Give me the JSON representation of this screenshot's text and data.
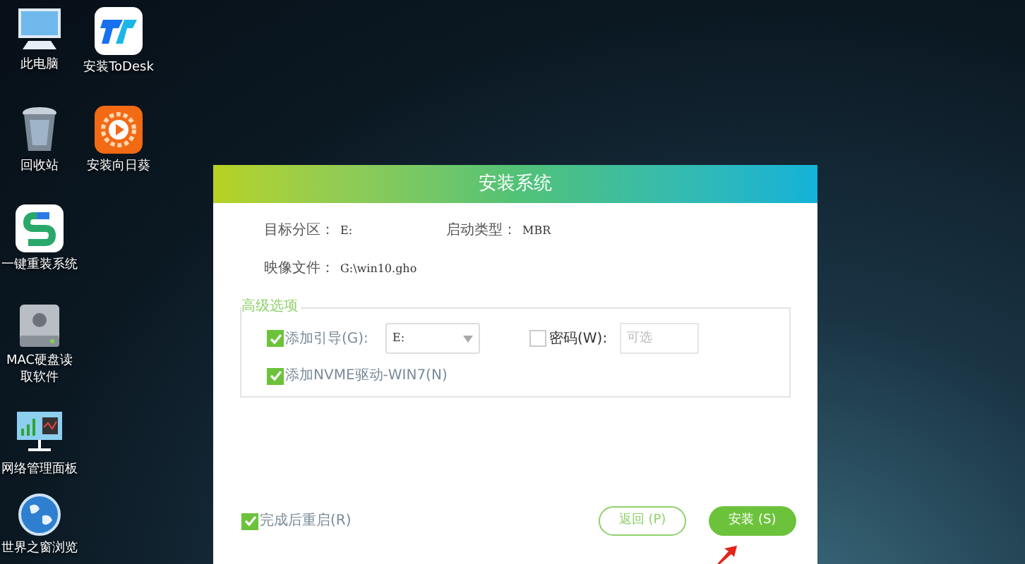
{
  "desktop_icons": [
    {
      "label": "此电脑",
      "kind": "computer"
    },
    {
      "label": "安装ToDesk",
      "kind": "todesk"
    },
    {
      "label": "回收站",
      "kind": "trash"
    },
    {
      "label": "安装向日葵",
      "kind": "sunflower"
    },
    {
      "label": "一键重装系统",
      "kind": "reinstall"
    },
    {
      "label": "MAC硬盘读取软件",
      "kind": "disk"
    },
    {
      "label": "网络管理面板",
      "kind": "network"
    },
    {
      "label": "世界之窗浏览",
      "kind": "globe"
    }
  ],
  "dialog": {
    "title": "安装系统",
    "info": [
      {
        "label": "目标分区：",
        "value": "E:"
      },
      {
        "label": "启动类型：",
        "value": "MBR"
      },
      {
        "label": "映像文件：",
        "value": "G:\\win10.gho"
      }
    ],
    "advanced": {
      "legend": "高级选项",
      "boot": {
        "label": "添加引导(G):",
        "checked": true,
        "value": "E:"
      },
      "password": {
        "label": "密码(W):",
        "checked": false,
        "placeholder": "可选"
      },
      "nvme": {
        "label": "添加NVME驱动-WIN7(N)",
        "checked": true
      }
    },
    "restart": {
      "label": "完成后重启(R)",
      "checked": true
    },
    "buttons": [
      {
        "label": "返回 (P)",
        "kind": "outline"
      },
      {
        "label": "安装 (S)",
        "kind": "primary"
      }
    ]
  }
}
